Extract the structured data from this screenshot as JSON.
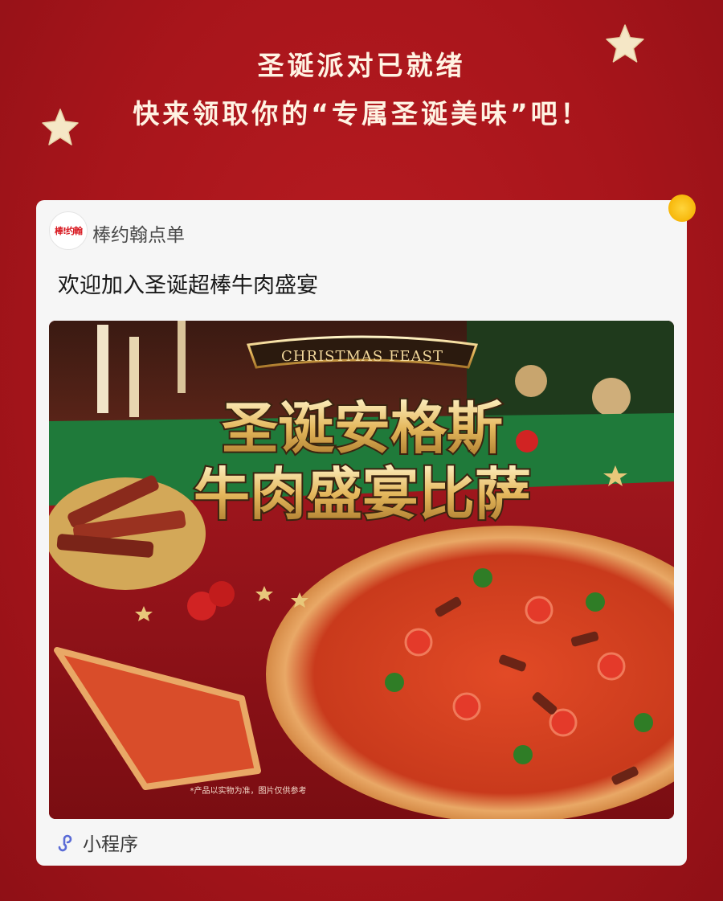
{
  "headline": {
    "line1": "圣诞派对已就绪",
    "line2": "快来领取你的“专属圣诞美味”吧！"
  },
  "card": {
    "account_logo_text": "棒!约翰",
    "account_name": "棒约翰点单",
    "message_title": "欢迎加入圣诞超棒牛肉盛宴",
    "hero": {
      "banner_text": "CHRISTMAS FEAST",
      "title_line1": "圣诞安格斯",
      "title_line2": "牛肉盛宴比萨",
      "disclaimer": "*产品以实物为准，图片仅供参考"
    },
    "footer_label": "小程序",
    "footer_icon": "mini-program-icon"
  },
  "colors": {
    "background": "#a8151b",
    "card": "#f6f6f6",
    "headline_text": "#fff3e3",
    "star": "#f5e7c6",
    "footer_icon": "#5a6bd6"
  }
}
